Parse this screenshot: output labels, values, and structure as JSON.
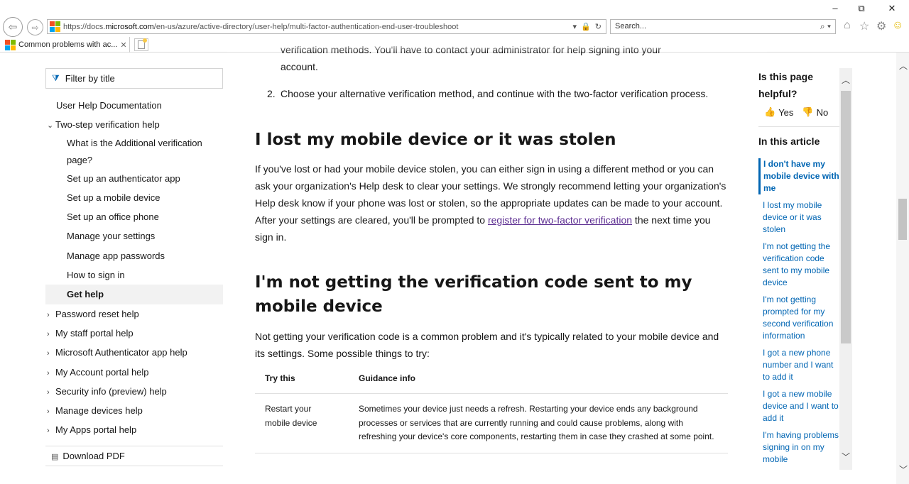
{
  "browser": {
    "url_prefix": "https://docs.",
    "url_domain": "microsoft.com",
    "url_rest": "/en-us/azure/active-directory/user-help/multi-factor-authentication-end-user-troubleshoot",
    "search_placeholder": "Search...",
    "tab_title": "Common problems with ac...",
    "tab_close": "✕",
    "win_min": "–",
    "win_max": "⧉",
    "win_close": "✕"
  },
  "left_nav": {
    "filter_placeholder": "Filter by title",
    "items": [
      {
        "label": "User Help Documentation"
      },
      {
        "label": "Two-step verification help"
      },
      {
        "label": "What is the Additional verification page?"
      },
      {
        "label": "Set up an authenticator app"
      },
      {
        "label": "Set up a mobile device"
      },
      {
        "label": "Set up an office phone"
      },
      {
        "label": "Manage your settings"
      },
      {
        "label": "Manage app passwords"
      },
      {
        "label": "How to sign in"
      },
      {
        "label": "Get help"
      },
      {
        "label": "Password reset help"
      },
      {
        "label": "My staff portal help"
      },
      {
        "label": "Microsoft Authenticator app help"
      },
      {
        "label": "My Account portal help"
      },
      {
        "label": "Security info (preview) help"
      },
      {
        "label": "Manage devices help"
      },
      {
        "label": "My Apps portal help"
      }
    ],
    "download_pdf": "Download PDF"
  },
  "content": {
    "cut_line": "verification methods. You'll have to contact your administrator for help signing into your",
    "cut_line_2": "account.",
    "step2_num": "2.",
    "step2": "Choose your alternative verification method, and continue with the two-factor verification process.",
    "h_lost": "I lost my mobile device or it was stolen",
    "p_lost_1": "If you've lost or had your mobile device stolen, you can either sign in using a different method or you can ask your organization's Help desk to clear your settings. We strongly recommend letting your organization's Help desk know if your phone was lost or stolen, so the appropriate updates can be made to your account. After your settings are cleared, you'll be prompted to ",
    "p_lost_link": "register for two-factor verification",
    "p_lost_2": " the next time you sign in.",
    "h_code": "I'm not getting the verification code sent to my mobile device",
    "p_code": "Not getting your verification code is a common problem and it's typically related to your mobile device and its settings. Some possible things to try:",
    "table": {
      "headers": [
        "Try this",
        "Guidance info"
      ],
      "rows": [
        [
          "Restart your mobile device",
          "Sometimes your device just needs a refresh. Restarting your device ends any background processes or services that are currently running and could cause problems, along with refreshing your device's core components, restarting them in case they crashed at some point."
        ]
      ]
    }
  },
  "rail": {
    "helpful_q": "Is this page helpful?",
    "yes": "Yes",
    "no": "No",
    "in_this_article": "In this article",
    "links": [
      "I don't have my mobile device with me",
      "I lost my mobile device or it was stolen",
      "I'm not getting the verification code sent to my mobile device",
      "I'm not getting prompted for my second verification information",
      "I got a new phone number and I want to add it",
      "I got a new mobile device and I want to add it",
      "I'm having problems signing in on my mobile"
    ]
  },
  "colors": {
    "link": "#0065b3",
    "visited_link": "#5c2d91",
    "active_bg": "#f2f2f2"
  }
}
